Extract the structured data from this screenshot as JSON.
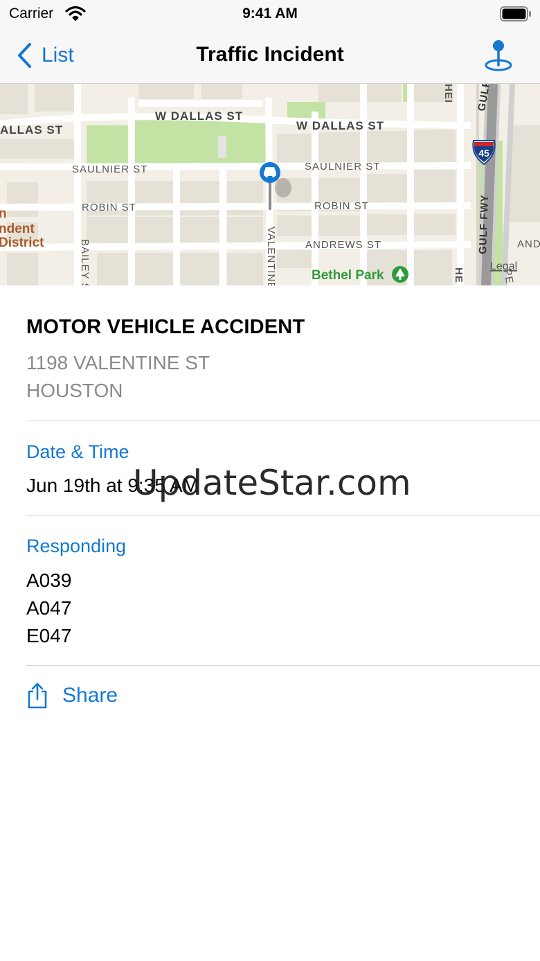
{
  "status_bar": {
    "carrier": "Carrier",
    "time": "9:41 AM"
  },
  "nav": {
    "back_label": "List",
    "title": "Traffic Incident",
    "action_icon": "map-pin-icon"
  },
  "map": {
    "streets": [
      "W DALLAS ST",
      "W DALLAS ST",
      "ALLAS ST",
      "SAULNIER ST",
      "SAULNIER ST",
      "ROBIN ST",
      "ROBIN ST",
      "ANDREWS ST",
      "BAILEY S",
      "VALENTINE",
      "HEI",
      "GULF",
      "GULF FWY",
      "HE",
      "AND",
      "PE"
    ],
    "poi": "Bethel Park",
    "district_lines": [
      "n",
      "ndent",
      "District"
    ],
    "highway_shield": "45",
    "legal": "Legal",
    "marker_icon": "car-icon"
  },
  "incident": {
    "type": "MOTOR VEHICLE ACCIDENT",
    "address_line1": "1198 VALENTINE ST",
    "address_line2": "HOUSTON"
  },
  "date_section": {
    "label": "Date & Time",
    "value": "Jun 19th at 9:35 AM"
  },
  "responding_section": {
    "label": "Responding",
    "units": [
      "A039",
      "A047",
      "E047"
    ]
  },
  "share": {
    "label": "Share",
    "icon": "share-icon"
  },
  "watermark": "UpdateStar.com",
  "colors": {
    "accent": "#1478d4",
    "secondary_text": "#8a8a8e",
    "park": "#c3e3a4",
    "map_bg": "#f3efe6",
    "poi_green": "#2e9b3c",
    "district_brown": "#a85a2a"
  }
}
